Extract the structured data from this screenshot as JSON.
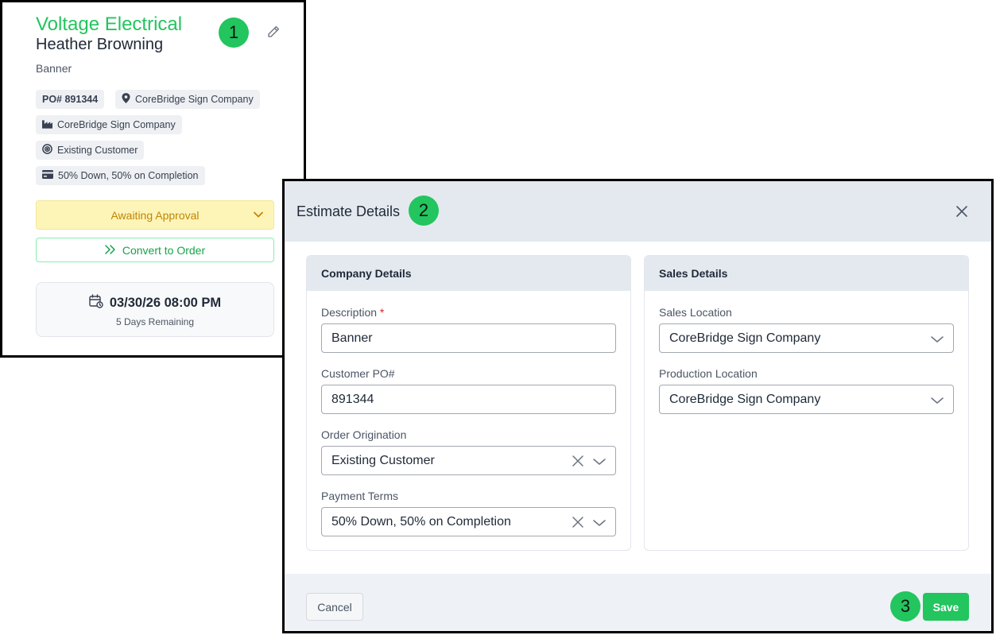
{
  "card": {
    "company_name": "Voltage Electrical",
    "contact_name": "Heather Browning",
    "description": "Banner",
    "po_chip": "PO# 891344",
    "location_chip": "CoreBridge Sign Company",
    "production_chip": "CoreBridge Sign Company",
    "origination_chip": "Existing Customer",
    "terms_chip": "50% Down, 50% on Completion",
    "status": "Awaiting Approval",
    "convert_label": "Convert to Order",
    "due_date": "03/30/26 08:00 PM",
    "due_remaining": "5 Days Remaining"
  },
  "callouts": [
    "1",
    "2",
    "3"
  ],
  "modal": {
    "title": "Estimate Details",
    "company_panel": {
      "header": "Company Details",
      "description_label": "Description",
      "description_required": "*",
      "description_value": "Banner",
      "po_label": "Customer PO#",
      "po_value": "891344",
      "origination_label": "Order Origination",
      "origination_value": "Existing Customer",
      "terms_label": "Payment Terms",
      "terms_value": "50% Down, 50% on Completion"
    },
    "sales_panel": {
      "header": "Sales Details",
      "sales_location_label": "Sales Location",
      "sales_location_value": "CoreBridge Sign Company",
      "production_location_label": "Production Location",
      "production_location_value": "CoreBridge Sign Company"
    },
    "footer": {
      "cancel_label": "Cancel",
      "save_label": "Save"
    }
  },
  "colors": {
    "accent_green": "#22c55e",
    "status_bg": "#fdf5b8",
    "status_text": "#c28407",
    "header_bg": "#e4e9f0"
  },
  "icons": [
    "pencil-icon",
    "map-pin-icon",
    "factory-icon",
    "target-icon",
    "credit-card-icon",
    "chevron-down-icon",
    "double-chevron-right-icon",
    "calendar-clock-icon",
    "close-icon",
    "clear-x-icon"
  ]
}
